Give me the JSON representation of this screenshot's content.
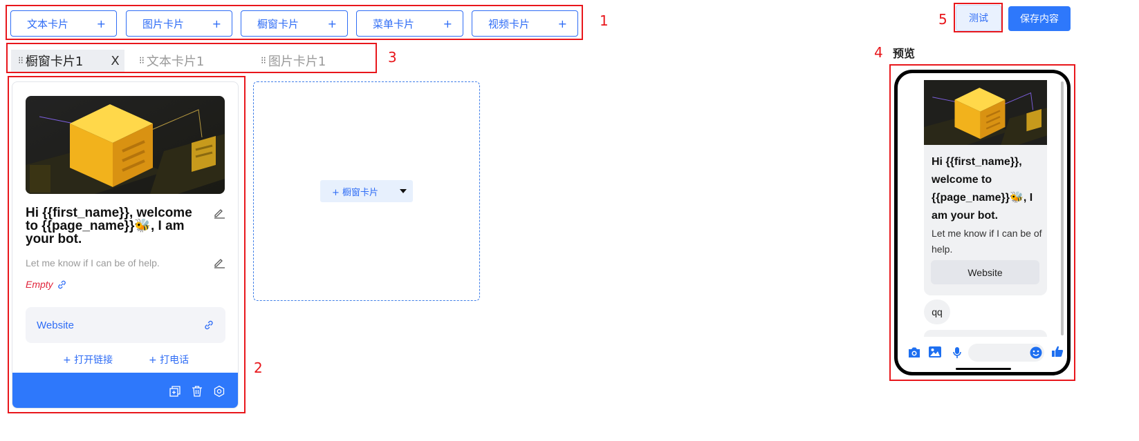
{
  "card_types": [
    {
      "label": "文本卡片",
      "plus": "+"
    },
    {
      "label": "图片卡片",
      "plus": "+"
    },
    {
      "label": "橱窗卡片",
      "plus": "+"
    },
    {
      "label": "菜单卡片",
      "plus": "+"
    },
    {
      "label": "视频卡片",
      "plus": "+"
    }
  ],
  "annotations": {
    "n1": "1",
    "n2": "2",
    "n3": "3",
    "n4": "4",
    "n5": "5"
  },
  "tabs": [
    {
      "grip": "⁝⁝",
      "label": "橱窗卡片1",
      "close": "X",
      "state": "active"
    },
    {
      "grip": "⁝⁝",
      "label": "文本卡片1",
      "state": "inactive"
    },
    {
      "grip": "⁝⁝",
      "label": "图片卡片1",
      "state": "inactive"
    }
  ],
  "editor_card": {
    "title": "Hi {{first_name}}, welcome to {{page_name}}🐝, I am your bot.",
    "subtitle": "Let me know if I can be of help.",
    "empty_link": "Empty",
    "button_label": "Website",
    "action_open_link": "+ 打开链接",
    "action_call": "+ 打电话"
  },
  "add_area": {
    "button_label": "+ 橱窗卡片"
  },
  "toolbar": {
    "test_label": "测试",
    "save_label": "保存内容"
  },
  "preview": {
    "label": "预览",
    "card_title": "Hi {{first_name}}, welcome to {{page_name}}🐝, I am your bot.",
    "card_subtitle": "Let me know if I can be of help.",
    "card_button": "Website",
    "message_qq": "qq"
  },
  "colors": {
    "accent": "#2e6cf5",
    "footer": "#2e78fb",
    "annotation": "#e8161b",
    "empty": "#e0243b"
  }
}
